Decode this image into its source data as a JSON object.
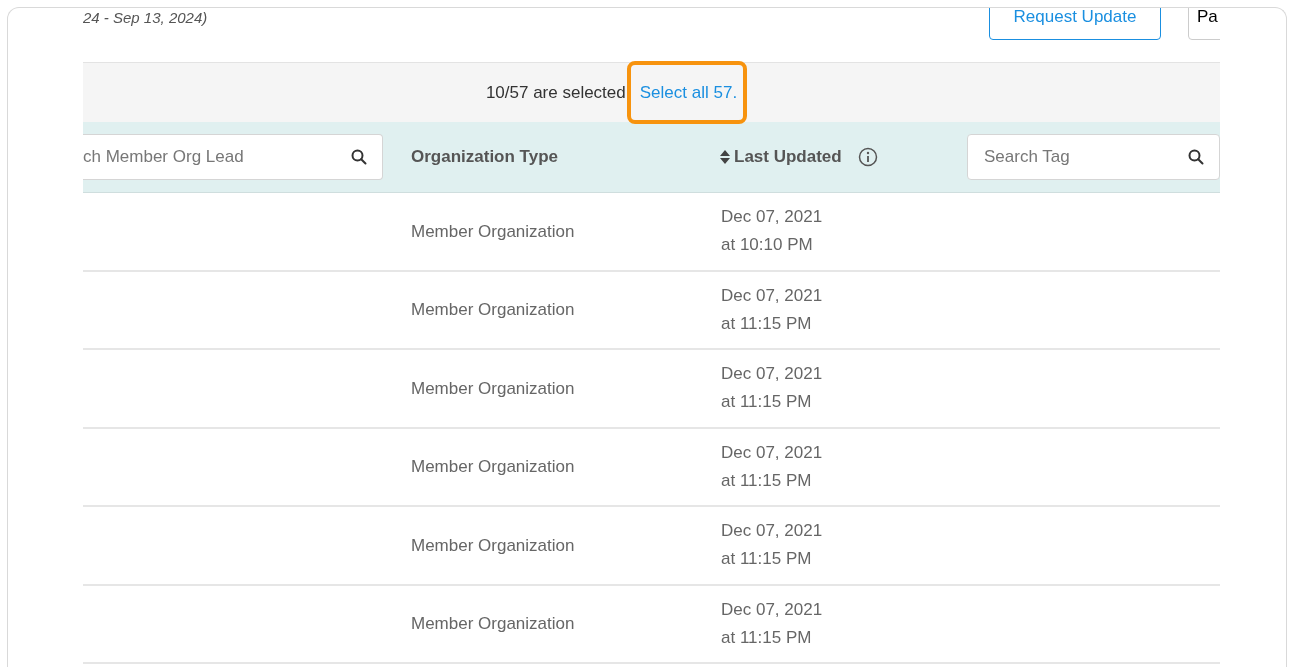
{
  "header": {
    "date_range": "24 - Sep 13, 2024)",
    "request_button": "Request Update",
    "cut_button": "Pa"
  },
  "selection_bar": {
    "message": "10/57 are selected",
    "select_all_link": "Select all 57.",
    "highlighted": true
  },
  "table": {
    "columns": [
      {
        "kind": "search",
        "placeholder": "ch Member Org Lead"
      },
      {
        "kind": "label",
        "label": "Organization Type"
      },
      {
        "kind": "sort",
        "label": "Last Updated"
      },
      {
        "kind": "search",
        "placeholder": "Search Tag"
      }
    ],
    "rows": [
      {
        "organization_type": "Member Organization",
        "date": "Dec 07, 2021",
        "time": "at 10:10 PM"
      },
      {
        "organization_type": "Member Organization",
        "date": "Dec 07, 2021",
        "time": "at 11:15 PM"
      },
      {
        "organization_type": "Member Organization",
        "date": "Dec 07, 2021",
        "time": "at 11:15 PM"
      },
      {
        "organization_type": "Member Organization",
        "date": "Dec 07, 2021",
        "time": "at 11:15 PM"
      },
      {
        "organization_type": "Member Organization",
        "date": "Dec 07, 2021",
        "time": "at 11:15 PM"
      },
      {
        "organization_type": "Member Organization",
        "date": "Dec 07, 2021",
        "time": "at 11:15 PM"
      }
    ]
  }
}
